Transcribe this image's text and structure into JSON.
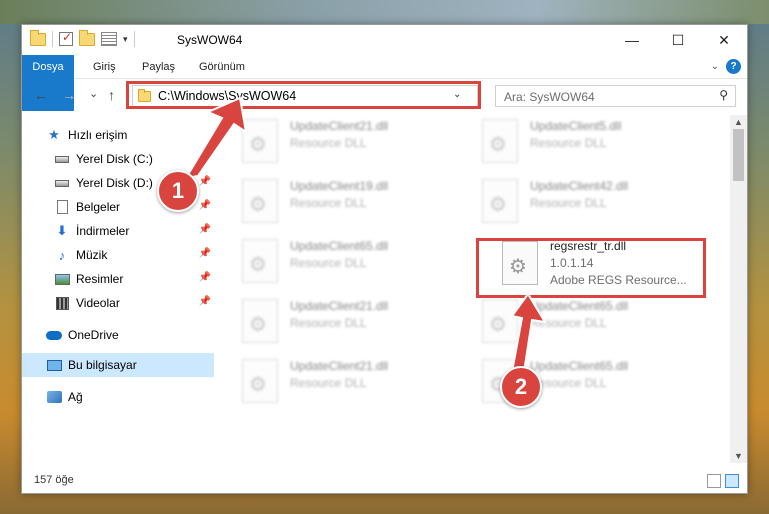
{
  "window": {
    "title": "SysWOW64",
    "caption": {
      "minimize": "—",
      "maximize": "☐",
      "close": "✕"
    }
  },
  "ribbon": {
    "tabs": [
      "Dosya",
      "Giriş",
      "Paylaş",
      "Görünüm"
    ],
    "help": "?"
  },
  "navbar": {
    "back": "←",
    "forward": "→",
    "recent": "⌄",
    "up": "↑",
    "address": "C:\\Windows\\SysWOW64",
    "refresh": "↻",
    "search_placeholder": "Ara: SysWOW64"
  },
  "sidebar": {
    "items": [
      {
        "label": "Hızlı erişim",
        "icon": "star-icon"
      },
      {
        "label": "Yerel Disk (C:)",
        "icon": "drive-icon",
        "pinned": true
      },
      {
        "label": "Yerel Disk (D:)",
        "icon": "drive-icon",
        "pinned": true
      },
      {
        "label": "Belgeler",
        "icon": "documents-icon",
        "pinned": true
      },
      {
        "label": "İndirmeler",
        "icon": "downloads-icon",
        "pinned": true
      },
      {
        "label": "Müzik",
        "icon": "music-icon",
        "pinned": true
      },
      {
        "label": "Resimler",
        "icon": "pictures-icon",
        "pinned": true
      },
      {
        "label": "Videolar",
        "icon": "videos-icon",
        "pinned": true
      },
      {
        "label": "OneDrive",
        "icon": "onedrive-icon"
      },
      {
        "label": "Bu bilgisayar",
        "icon": "computer-icon",
        "selected": true
      },
      {
        "label": "Ağ",
        "icon": "network-icon"
      }
    ]
  },
  "files": [
    {
      "name": "UpdateClient21.dll",
      "type": "Resource DLL"
    },
    {
      "name": "UpdateClient5.dll",
      "type": "Resource DLL"
    },
    {
      "name": "UpdateClient19.dll",
      "type": "Resource DLL"
    },
    {
      "name": "UpdateClient42.dll",
      "type": "Resource DLL"
    },
    {
      "name": "UpdateClient65.dll",
      "type": "Resource DLL"
    },
    {
      "name": "regsrestr_tr.dll",
      "version": "1.0.1.14",
      "type": "Adobe REGS Resource..."
    },
    {
      "name": "UpdateClient21.dll",
      "type": "Resource DLL"
    },
    {
      "name": "UpdateClient65.dll",
      "type": "Resource DLL"
    },
    {
      "name": "UpdateClient21.dll",
      "type": "Resource DLL"
    },
    {
      "name": "UpdateClient65.dll",
      "type": "Resource DLL"
    }
  ],
  "status": {
    "count": "157 öğe"
  },
  "annotations": {
    "badge1": "1",
    "badge2": "2",
    "color": "#d9443f"
  }
}
